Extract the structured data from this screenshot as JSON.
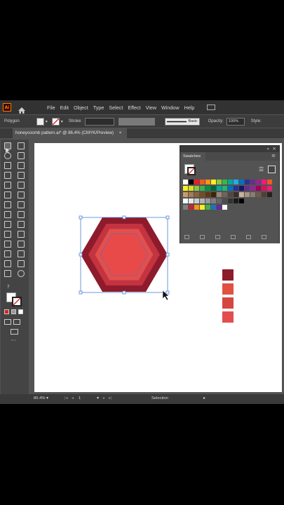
{
  "menu": {
    "app_icon": "Ai",
    "items": [
      "File",
      "Edit",
      "Object",
      "Type",
      "Select",
      "Effect",
      "View",
      "Window",
      "Help"
    ]
  },
  "control_bar": {
    "shape_label": "Polygon",
    "stroke_label": "Stroke:",
    "brush_label": "Basic",
    "opacity_label": "Opacity:",
    "opacity_value": "100%",
    "style_label": "Style:"
  },
  "document": {
    "tab_title": "honeycoomb pattern.ai* @ 86.4% (CMYK/Preview)",
    "close_glyph": "×"
  },
  "status": {
    "zoom": "86.4%",
    "page": "1",
    "tool": "Selection"
  },
  "swatches_panel": {
    "title": "Swatches",
    "grid_colors": [
      [
        "#ffffff",
        "#000000",
        "#ed1c24",
        "#f15a24",
        "#f7931e",
        "#fcee21",
        "#8cc63f",
        "#39b54a",
        "#00a99d",
        "#29abe2",
        "#0071bc",
        "#2e3192",
        "#662d91",
        "#93278f",
        "#ed1e79",
        "#f15a24"
      ],
      [
        "#fcee21",
        "#d9e021",
        "#8cc63f",
        "#39b54a",
        "#009245",
        "#006837",
        "#00a99d",
        "#22b573",
        "#0071bc",
        "#2e3192",
        "#1b1464",
        "#662d91",
        "#93278f",
        "#9e005d",
        "#d4145a",
        "#ed1e79"
      ],
      [
        "#c69c6d",
        "#a67c52",
        "#8c6239",
        "#754c24",
        "#603813",
        "#42210b",
        "#998675",
        "#736357",
        "#534741",
        "#362f2d",
        "#c7b299",
        "#a69580",
        "#8c7c70",
        "#6c5c4e",
        "#4d4037",
        "#2a201b"
      ],
      [
        "#ffffff",
        "#e6e6e6",
        "#cccccc",
        "#b3b3b3",
        "#999999",
        "#808080",
        "#666666",
        "#4d4d4d",
        "#333333",
        "#1a1a1a",
        "#000000"
      ],
      [
        "#808080",
        "#c1272d",
        "#f7931e",
        "#fcee21",
        "#39b54a",
        "#1c75bc",
        "#662d91",
        "#ffffff"
      ]
    ]
  },
  "artwork": {
    "hex_colors": [
      "#8e1b2b",
      "#c43340",
      "#e2504c",
      "#e84a4a"
    ],
    "sample_swatches": [
      "#8e1b2b",
      "#e2503f",
      "#d64640",
      "#e34d50"
    ]
  }
}
